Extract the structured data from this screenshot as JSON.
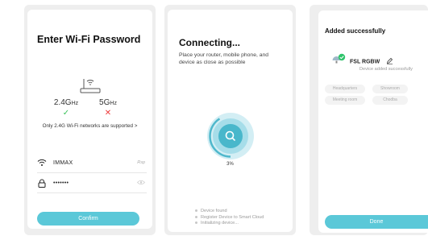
{
  "wifi_screen": {
    "title": "Enter Wi-Fi Password",
    "band_24": "2.4G",
    "band_24_unit": "Hz",
    "band_5": "5G",
    "band_5_unit": "Hz",
    "check_mark": "✓",
    "cross_mark": "✕",
    "support_note": "Only 2.4G Wi-Fi networks are supported",
    "support_chevron": ">",
    "ssid": "IMMAX",
    "switch_link": "Rsp",
    "password": "•••••••",
    "confirm_label": "Confirm",
    "colors": {
      "accent": "#5bc8d8",
      "ok": "#3cc35b",
      "error": "#ee3b3b"
    }
  },
  "connecting_screen": {
    "title": "Connecting...",
    "description": "Place your router, mobile phone, and device as close as possible",
    "progress_percent": 3,
    "progress_label": "3%",
    "steps": [
      "Device found",
      "Register Device to Smart Cloud",
      "Initializing device..."
    ]
  },
  "added_screen": {
    "title": "Added successfully",
    "device_name": "FSL RGBW",
    "device_status": "Device added successfully",
    "rooms": [
      "Headquarters",
      "Showroom",
      "Meeting room",
      "Chodba"
    ],
    "done_label": "Done"
  }
}
